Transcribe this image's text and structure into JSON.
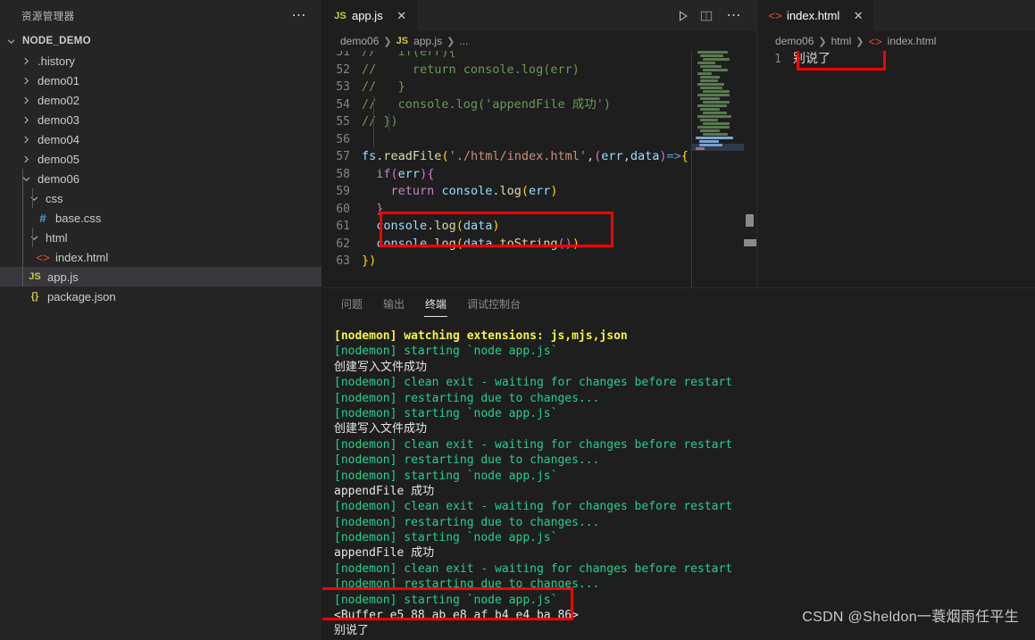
{
  "sidebar": {
    "header_title": "资源管理器",
    "more_icon": "ellipsis-icon",
    "root": {
      "label": "NODE_DEMO",
      "expanded": true
    },
    "items": [
      {
        "label": ".history",
        "type": "folder",
        "expanded": false,
        "depth": 1
      },
      {
        "label": "demo01",
        "type": "folder",
        "expanded": false,
        "depth": 1
      },
      {
        "label": "demo02",
        "type": "folder",
        "expanded": false,
        "depth": 1
      },
      {
        "label": "demo03",
        "type": "folder",
        "expanded": false,
        "depth": 1
      },
      {
        "label": "demo04",
        "type": "folder",
        "expanded": false,
        "depth": 1
      },
      {
        "label": "demo05",
        "type": "folder",
        "expanded": false,
        "depth": 1
      },
      {
        "label": "demo06",
        "type": "folder",
        "expanded": true,
        "depth": 1
      },
      {
        "label": "css",
        "type": "folder",
        "expanded": true,
        "depth": 2
      },
      {
        "label": "base.css",
        "type": "css",
        "icon": "#",
        "depth": 3
      },
      {
        "label": "html",
        "type": "folder",
        "expanded": true,
        "depth": 2
      },
      {
        "label": "index.html",
        "type": "html",
        "icon": "<>",
        "depth": 3
      },
      {
        "label": "app.js",
        "type": "js",
        "icon": "JS",
        "depth": 2,
        "selected": true
      },
      {
        "label": "package.json",
        "type": "json",
        "icon": "{}",
        "depth": 2
      }
    ]
  },
  "editor_left": {
    "tab": {
      "label": "app.js",
      "icon": "JS",
      "close_icon": "close-icon",
      "active": true
    },
    "actions": [
      {
        "name": "run-code-button",
        "icon": "play-icon"
      },
      {
        "name": "split-editor-button",
        "icon": "split-editor-icon"
      },
      {
        "name": "more-actions-button",
        "icon": "ellipsis-icon"
      }
    ],
    "breadcrumb": [
      "demo06",
      "app.js",
      "..."
    ],
    "first_line_number": 51,
    "lines": [
      {
        "n": 51,
        "tokens": [
          {
            "t": "//   if(err){",
            "c": "c-com"
          }
        ]
      },
      {
        "n": 52,
        "tokens": [
          {
            "t": "//     return console.log(err)",
            "c": "c-com"
          }
        ]
      },
      {
        "n": 53,
        "tokens": [
          {
            "t": "//   }",
            "c": "c-com"
          }
        ]
      },
      {
        "n": 54,
        "tokens": [
          {
            "t": "//   console.log('appendFile 成功')",
            "c": "c-com"
          }
        ]
      },
      {
        "n": 55,
        "tokens": [
          {
            "t": "// })",
            "c": "c-com"
          }
        ]
      },
      {
        "n": 56,
        "tokens": [
          {
            "t": "",
            "c": "c-op"
          }
        ]
      },
      {
        "n": 57,
        "tokens": [
          {
            "t": "fs",
            "c": "c-var"
          },
          {
            "t": ".",
            "c": "c-op"
          },
          {
            "t": "readFile",
            "c": "c-fn"
          },
          {
            "t": "(",
            "c": "c-punc"
          },
          {
            "t": "'./html/index.html'",
            "c": "c-str"
          },
          {
            "t": ",",
            "c": "c-op"
          },
          {
            "t": "(",
            "c": "c-punc2"
          },
          {
            "t": "err",
            "c": "c-var"
          },
          {
            "t": ",",
            "c": "c-op"
          },
          {
            "t": "data",
            "c": "c-var"
          },
          {
            "t": ")",
            "c": "c-punc2"
          },
          {
            "t": "=>",
            "c": "c-key2"
          },
          {
            "t": "{",
            "c": "c-punc"
          }
        ]
      },
      {
        "n": 58,
        "tokens": [
          {
            "t": "  ",
            "c": "c-op"
          },
          {
            "t": "if",
            "c": "c-kw"
          },
          {
            "t": "(",
            "c": "c-punc2"
          },
          {
            "t": "err",
            "c": "c-var"
          },
          {
            "t": ")",
            "c": "c-punc2"
          },
          {
            "t": "{",
            "c": "c-punc2"
          }
        ]
      },
      {
        "n": 59,
        "tokens": [
          {
            "t": "    ",
            "c": "c-op"
          },
          {
            "t": "return",
            "c": "c-kw"
          },
          {
            "t": " ",
            "c": "c-op"
          },
          {
            "t": "console",
            "c": "c-var"
          },
          {
            "t": ".",
            "c": "c-op"
          },
          {
            "t": "log",
            "c": "c-fn"
          },
          {
            "t": "(",
            "c": "c-punc"
          },
          {
            "t": "err",
            "c": "c-var"
          },
          {
            "t": ")",
            "c": "c-punc"
          }
        ]
      },
      {
        "n": 60,
        "tokens": [
          {
            "t": "  ",
            "c": "c-op"
          },
          {
            "t": "}",
            "c": "c-punc2"
          }
        ]
      },
      {
        "n": 61,
        "tokens": [
          {
            "t": "  ",
            "c": "c-op"
          },
          {
            "t": "console",
            "c": "c-var"
          },
          {
            "t": ".",
            "c": "c-op"
          },
          {
            "t": "log",
            "c": "c-fn"
          },
          {
            "t": "(",
            "c": "c-punc"
          },
          {
            "t": "data",
            "c": "c-var"
          },
          {
            "t": ")",
            "c": "c-punc"
          }
        ]
      },
      {
        "n": 62,
        "tokens": [
          {
            "t": "  ",
            "c": "c-op"
          },
          {
            "t": "console",
            "c": "c-var"
          },
          {
            "t": ".",
            "c": "c-op"
          },
          {
            "t": "log",
            "c": "c-fn"
          },
          {
            "t": "(",
            "c": "c-punc"
          },
          {
            "t": "data",
            "c": "c-var"
          },
          {
            "t": ".",
            "c": "c-op"
          },
          {
            "t": "toString",
            "c": "c-fn"
          },
          {
            "t": "(",
            "c": "c-punc2"
          },
          {
            "t": ")",
            "c": "c-punc2"
          },
          {
            "t": ")",
            "c": "c-punc"
          }
        ]
      },
      {
        "n": 63,
        "tokens": [
          {
            "t": "}",
            "c": "c-punc"
          },
          {
            "t": ")",
            "c": "c-punc"
          }
        ]
      }
    ],
    "highlight_note": "red box around lines 61-62"
  },
  "editor_right": {
    "tab": {
      "label": "index.html",
      "icon": "<>",
      "close_icon": "close-icon",
      "active": true
    },
    "breadcrumb": [
      "demo06",
      "html",
      "index.html"
    ],
    "lines": [
      {
        "n": 1,
        "text": "别说了"
      }
    ],
    "highlight_note": "red box around line 1 content"
  },
  "panel": {
    "tabs": [
      {
        "label": "问题",
        "active": false
      },
      {
        "label": "输出",
        "active": false
      },
      {
        "label": "终端",
        "active": true
      },
      {
        "label": "调试控制台",
        "active": false
      }
    ],
    "terminal_lines": [
      {
        "text": "[nodemon] watching extensions: js,mjs,json",
        "color": "t-yellow"
      },
      {
        "text": "[nodemon] starting `node app.js`",
        "color": "t-green"
      },
      {
        "text": "创建写入文件成功",
        "color": "t-white"
      },
      {
        "text": "[nodemon] clean exit - waiting for changes before restart",
        "color": "t-green"
      },
      {
        "text": "[nodemon] restarting due to changes...",
        "color": "t-green"
      },
      {
        "text": "[nodemon] starting `node app.js`",
        "color": "t-green"
      },
      {
        "text": "创建写入文件成功",
        "color": "t-white"
      },
      {
        "text": "[nodemon] clean exit - waiting for changes before restart",
        "color": "t-green"
      },
      {
        "text": "[nodemon] restarting due to changes...",
        "color": "t-green"
      },
      {
        "text": "[nodemon] starting `node app.js`",
        "color": "t-green"
      },
      {
        "text": "appendFile 成功",
        "color": "t-white"
      },
      {
        "text": "[nodemon] clean exit - waiting for changes before restart",
        "color": "t-green"
      },
      {
        "text": "[nodemon] restarting due to changes...",
        "color": "t-green"
      },
      {
        "text": "[nodemon] starting `node app.js`",
        "color": "t-green"
      },
      {
        "text": "appendFile 成功",
        "color": "t-white"
      },
      {
        "text": "[nodemon] clean exit - waiting for changes before restart",
        "color": "t-green"
      },
      {
        "text": "[nodemon] restarting due to changes...",
        "color": "t-green"
      },
      {
        "text": "[nodemon] starting `node app.js`",
        "color": "t-green"
      },
      {
        "text": "<Buffer e5 88 ab e8 af b4 e4 ba 86>",
        "color": "t-white"
      },
      {
        "text": "别说了",
        "color": "t-white"
      }
    ],
    "highlight_note": "red box around last two terminal lines"
  },
  "watermark": {
    "text": "CSDN @Sheldon一蓑烟雨任平生"
  },
  "colors": {
    "bg_editor": "#1e1e1e",
    "bg_sidebar": "#252526",
    "selection": "#37373d",
    "annotation_red": "#ff0000",
    "terminal_green": "#23d18b",
    "terminal_yellow": "#f5f543"
  }
}
